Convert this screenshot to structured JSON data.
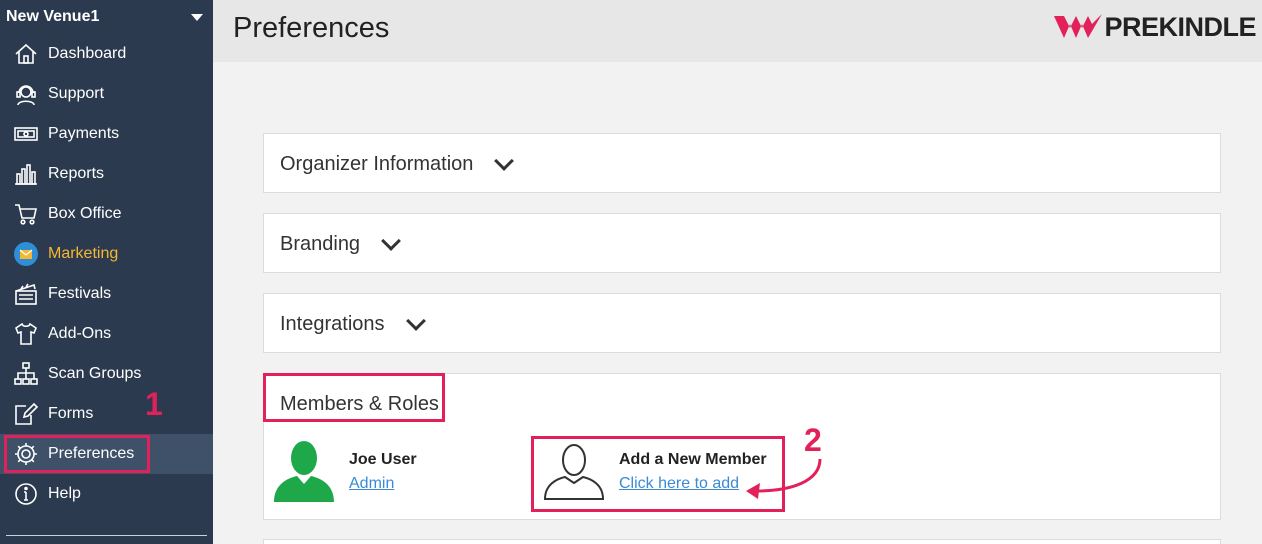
{
  "sidebar": {
    "venue": "New Venue1",
    "items": [
      {
        "label": "Dashboard",
        "icon": "home-icon"
      },
      {
        "label": "Support",
        "icon": "headset-icon"
      },
      {
        "label": "Payments",
        "icon": "cash-icon"
      },
      {
        "label": "Reports",
        "icon": "bar-chart-icon"
      },
      {
        "label": "Box Office",
        "icon": "cart-icon"
      },
      {
        "label": "Marketing",
        "icon": "mail-icon"
      },
      {
        "label": "Festivals",
        "icon": "clapperboard-icon"
      },
      {
        "label": "Add-Ons",
        "icon": "tshirt-icon"
      },
      {
        "label": "Scan Groups",
        "icon": "hierarchy-icon"
      },
      {
        "label": "Forms",
        "icon": "edit-form-icon"
      },
      {
        "label": "Preferences",
        "icon": "gear-icon"
      },
      {
        "label": "Help",
        "icon": "info-icon"
      }
    ]
  },
  "header": {
    "title": "Preferences",
    "logo": "PREKINDLE"
  },
  "sections": [
    {
      "title": "Organizer Information"
    },
    {
      "title": "Branding"
    },
    {
      "title": "Integrations"
    },
    {
      "title": "Members & Roles"
    }
  ],
  "members": [
    {
      "name": "Joe User",
      "role": "Admin"
    }
  ],
  "add_member": {
    "title": "Add a New Member",
    "link": "Click here to add"
  },
  "annotations": [
    "1",
    "2"
  ],
  "colors": {
    "sidebar_bg": "#2b3a4e",
    "accent_red": "#e2215b",
    "marketing": "#f5b731",
    "member_green": "#1ea84a",
    "link": "#3a8ad6"
  }
}
